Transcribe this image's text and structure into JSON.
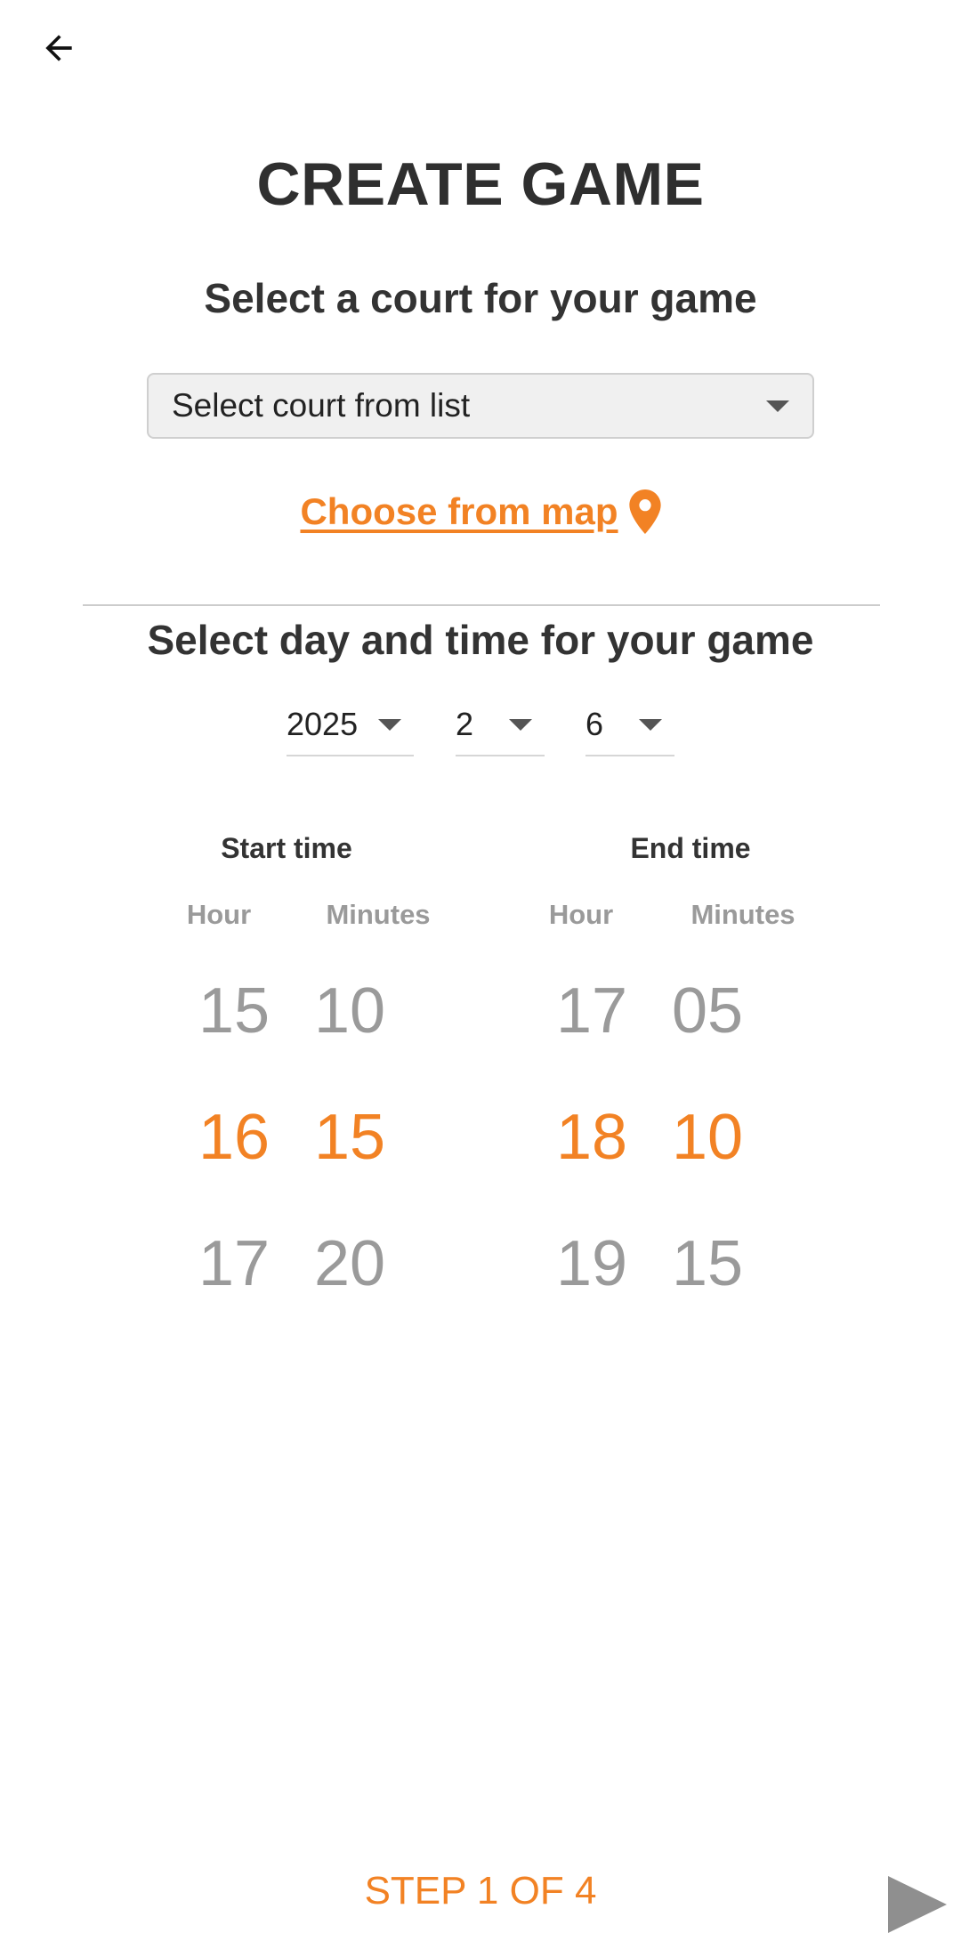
{
  "header": {
    "title": "CREATE GAME"
  },
  "court": {
    "heading": "Select a court for your game",
    "select_placeholder": "Select court from list",
    "map_link": "Choose from map"
  },
  "datetime": {
    "heading": "Select day and time for your game",
    "year": "2025",
    "month": "2",
    "day": "6"
  },
  "start_time": {
    "title": "Start time",
    "hour_label": "Hour",
    "minutes_label": "Minutes",
    "hours": [
      "15",
      "16",
      "17"
    ],
    "minutes": [
      "10",
      "15",
      "20"
    ],
    "selected_hour": "16",
    "selected_minutes": "15"
  },
  "end_time": {
    "title": "End time",
    "hour_label": "Hour",
    "minutes_label": "Minutes",
    "hours": [
      "17",
      "18",
      "19"
    ],
    "minutes": [
      "05",
      "10",
      "15"
    ],
    "selected_hour": "18",
    "selected_minutes": "10"
  },
  "footer": {
    "step_text": "STEP 1 OF 4"
  },
  "colors": {
    "accent": "#f28224",
    "muted": "#9a9a9a",
    "text": "#333333"
  }
}
